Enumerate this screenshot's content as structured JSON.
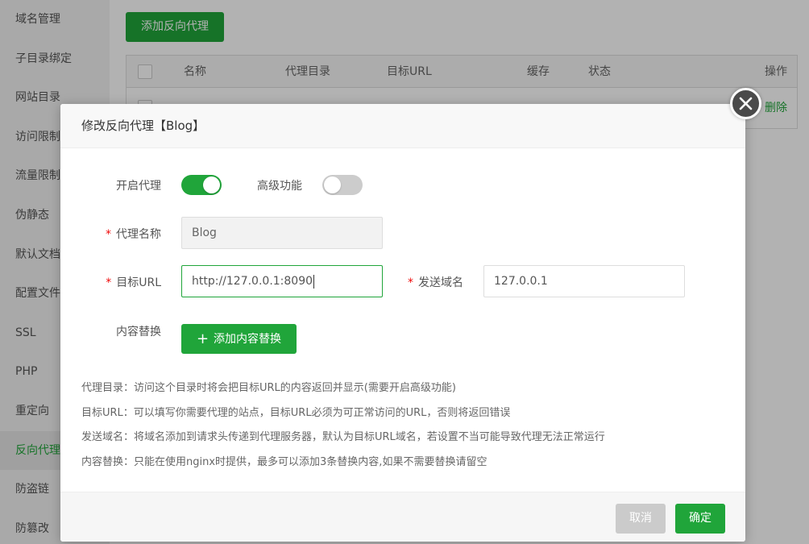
{
  "sidebar": {
    "items": [
      {
        "label": "域名管理"
      },
      {
        "label": "子目录绑定"
      },
      {
        "label": "网站目录"
      },
      {
        "label": "访问限制"
      },
      {
        "label": "流量限制"
      },
      {
        "label": "伪静态"
      },
      {
        "label": "默认文档"
      },
      {
        "label": "配置文件"
      },
      {
        "label": "SSL"
      },
      {
        "label": "PHP"
      },
      {
        "label": "重定向"
      },
      {
        "label": "反向代理"
      },
      {
        "label": "防盗链"
      },
      {
        "label": "防篡改"
      }
    ],
    "active_index": 11
  },
  "page": {
    "add_button": "添加反向代理",
    "table": {
      "headers": [
        "名称",
        "代理目录",
        "目标URL",
        "缓存",
        "状态",
        "操作"
      ],
      "row_delete": "删除"
    }
  },
  "modal": {
    "title": "修改反向代理【Blog】",
    "enable_proxy_label": "开启代理",
    "enable_proxy": true,
    "advanced_label": "高级功能",
    "advanced": false,
    "name_label": "代理名称",
    "name_value": "Blog",
    "target_url_label": "目标URL",
    "target_url_value": "http://127.0.0.1:8090",
    "send_domain_label": "发送域名",
    "send_domain_value": "127.0.0.1",
    "replace_label": "内容替换",
    "add_replace_button": "添加内容替换",
    "help": [
      "代理目录：访问这个目录时将会把目标URL的内容返回并显示(需要开启高级功能)",
      "目标URL：可以填写你需要代理的站点，目标URL必须为可正常访问的URL，否则将返回错误",
      "发送域名：将域名添加到请求头传递到代理服务器，默认为目标URL域名，若设置不当可能导致代理无法正常运行",
      "内容替换：只能在使用nginx时提供，最多可以添加3条替换内容,如果不需要替换请留空"
    ],
    "cancel": "取消",
    "confirm": "确定"
  },
  "colors": {
    "accent": "#20a53a",
    "required": "#ef0808"
  }
}
